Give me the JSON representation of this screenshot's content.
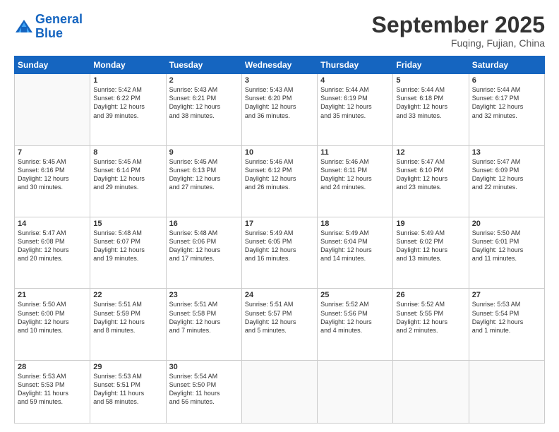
{
  "logo": {
    "line1": "General",
    "line2": "Blue"
  },
  "title": "September 2025",
  "location": "Fuqing, Fujian, China",
  "headers": [
    "Sunday",
    "Monday",
    "Tuesday",
    "Wednesday",
    "Thursday",
    "Friday",
    "Saturday"
  ],
  "weeks": [
    [
      {
        "day": "",
        "info": ""
      },
      {
        "day": "1",
        "info": "Sunrise: 5:42 AM\nSunset: 6:22 PM\nDaylight: 12 hours\nand 39 minutes."
      },
      {
        "day": "2",
        "info": "Sunrise: 5:43 AM\nSunset: 6:21 PM\nDaylight: 12 hours\nand 38 minutes."
      },
      {
        "day": "3",
        "info": "Sunrise: 5:43 AM\nSunset: 6:20 PM\nDaylight: 12 hours\nand 36 minutes."
      },
      {
        "day": "4",
        "info": "Sunrise: 5:44 AM\nSunset: 6:19 PM\nDaylight: 12 hours\nand 35 minutes."
      },
      {
        "day": "5",
        "info": "Sunrise: 5:44 AM\nSunset: 6:18 PM\nDaylight: 12 hours\nand 33 minutes."
      },
      {
        "day": "6",
        "info": "Sunrise: 5:44 AM\nSunset: 6:17 PM\nDaylight: 12 hours\nand 32 minutes."
      }
    ],
    [
      {
        "day": "7",
        "info": "Sunrise: 5:45 AM\nSunset: 6:16 PM\nDaylight: 12 hours\nand 30 minutes."
      },
      {
        "day": "8",
        "info": "Sunrise: 5:45 AM\nSunset: 6:14 PM\nDaylight: 12 hours\nand 29 minutes."
      },
      {
        "day": "9",
        "info": "Sunrise: 5:45 AM\nSunset: 6:13 PM\nDaylight: 12 hours\nand 27 minutes."
      },
      {
        "day": "10",
        "info": "Sunrise: 5:46 AM\nSunset: 6:12 PM\nDaylight: 12 hours\nand 26 minutes."
      },
      {
        "day": "11",
        "info": "Sunrise: 5:46 AM\nSunset: 6:11 PM\nDaylight: 12 hours\nand 24 minutes."
      },
      {
        "day": "12",
        "info": "Sunrise: 5:47 AM\nSunset: 6:10 PM\nDaylight: 12 hours\nand 23 minutes."
      },
      {
        "day": "13",
        "info": "Sunrise: 5:47 AM\nSunset: 6:09 PM\nDaylight: 12 hours\nand 22 minutes."
      }
    ],
    [
      {
        "day": "14",
        "info": "Sunrise: 5:47 AM\nSunset: 6:08 PM\nDaylight: 12 hours\nand 20 minutes."
      },
      {
        "day": "15",
        "info": "Sunrise: 5:48 AM\nSunset: 6:07 PM\nDaylight: 12 hours\nand 19 minutes."
      },
      {
        "day": "16",
        "info": "Sunrise: 5:48 AM\nSunset: 6:06 PM\nDaylight: 12 hours\nand 17 minutes."
      },
      {
        "day": "17",
        "info": "Sunrise: 5:49 AM\nSunset: 6:05 PM\nDaylight: 12 hours\nand 16 minutes."
      },
      {
        "day": "18",
        "info": "Sunrise: 5:49 AM\nSunset: 6:04 PM\nDaylight: 12 hours\nand 14 minutes."
      },
      {
        "day": "19",
        "info": "Sunrise: 5:49 AM\nSunset: 6:02 PM\nDaylight: 12 hours\nand 13 minutes."
      },
      {
        "day": "20",
        "info": "Sunrise: 5:50 AM\nSunset: 6:01 PM\nDaylight: 12 hours\nand 11 minutes."
      }
    ],
    [
      {
        "day": "21",
        "info": "Sunrise: 5:50 AM\nSunset: 6:00 PM\nDaylight: 12 hours\nand 10 minutes."
      },
      {
        "day": "22",
        "info": "Sunrise: 5:51 AM\nSunset: 5:59 PM\nDaylight: 12 hours\nand 8 minutes."
      },
      {
        "day": "23",
        "info": "Sunrise: 5:51 AM\nSunset: 5:58 PM\nDaylight: 12 hours\nand 7 minutes."
      },
      {
        "day": "24",
        "info": "Sunrise: 5:51 AM\nSunset: 5:57 PM\nDaylight: 12 hours\nand 5 minutes."
      },
      {
        "day": "25",
        "info": "Sunrise: 5:52 AM\nSunset: 5:56 PM\nDaylight: 12 hours\nand 4 minutes."
      },
      {
        "day": "26",
        "info": "Sunrise: 5:52 AM\nSunset: 5:55 PM\nDaylight: 12 hours\nand 2 minutes."
      },
      {
        "day": "27",
        "info": "Sunrise: 5:53 AM\nSunset: 5:54 PM\nDaylight: 12 hours\nand 1 minute."
      }
    ],
    [
      {
        "day": "28",
        "info": "Sunrise: 5:53 AM\nSunset: 5:53 PM\nDaylight: 11 hours\nand 59 minutes."
      },
      {
        "day": "29",
        "info": "Sunrise: 5:53 AM\nSunset: 5:51 PM\nDaylight: 11 hours\nand 58 minutes."
      },
      {
        "day": "30",
        "info": "Sunrise: 5:54 AM\nSunset: 5:50 PM\nDaylight: 11 hours\nand 56 minutes."
      },
      {
        "day": "",
        "info": ""
      },
      {
        "day": "",
        "info": ""
      },
      {
        "day": "",
        "info": ""
      },
      {
        "day": "",
        "info": ""
      }
    ]
  ]
}
